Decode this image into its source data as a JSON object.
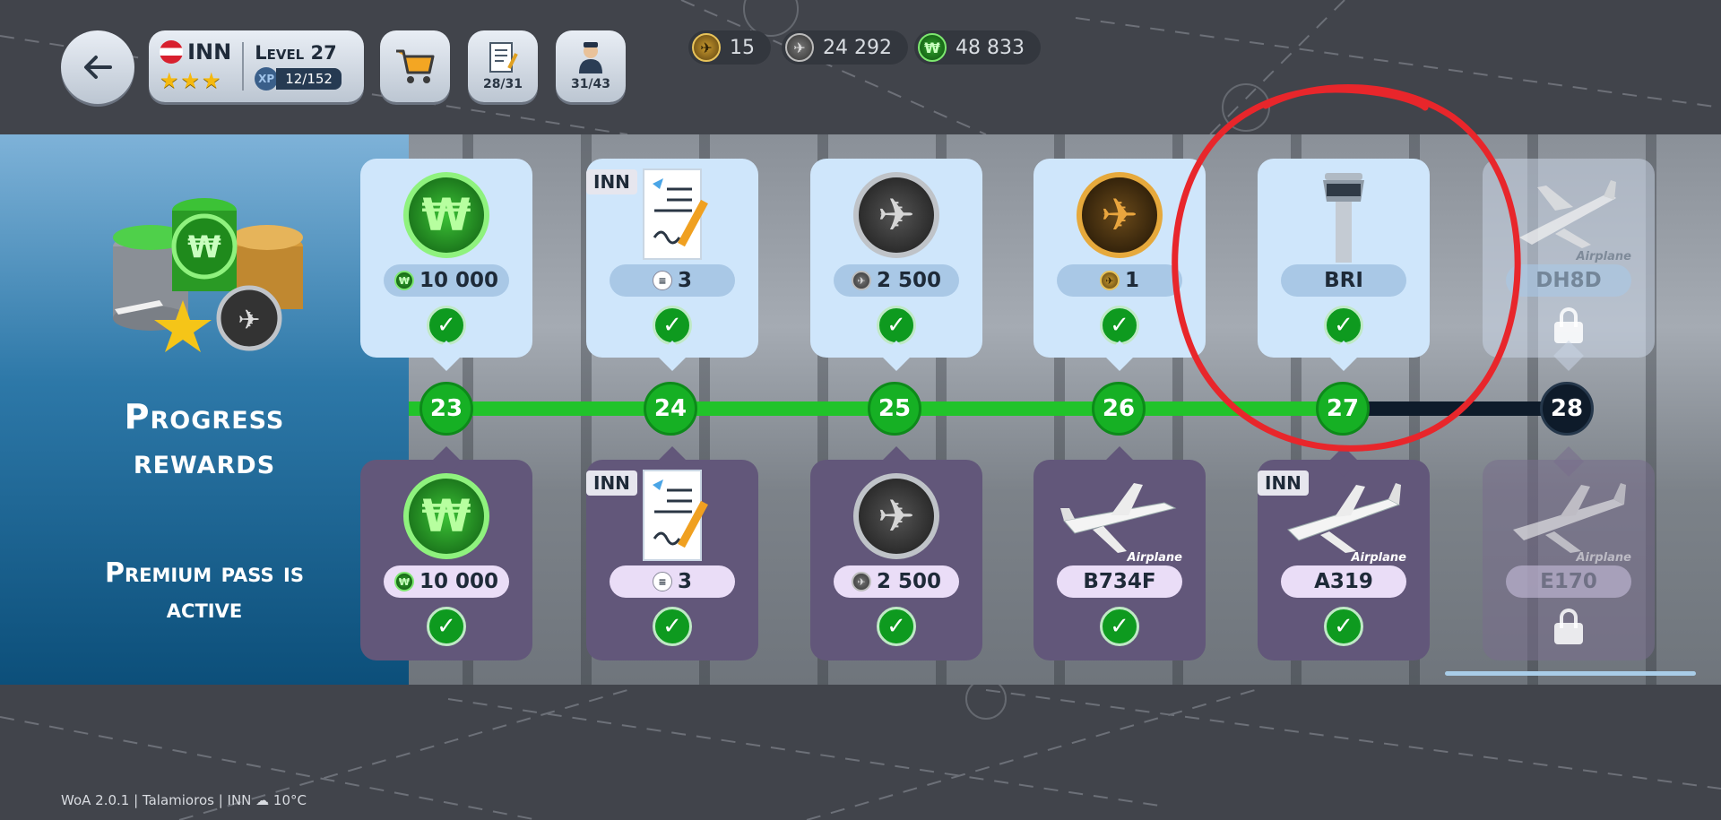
{
  "profile": {
    "code": "INN",
    "stars": "★★★",
    "level_label": "Level 27",
    "xp_label": "XP",
    "xp": "12/152"
  },
  "buttons": {
    "contracts_count": "28/31",
    "crew_count": "31/43"
  },
  "currencies": [
    {
      "icon": "gold-plane-coin-icon",
      "value": "15"
    },
    {
      "icon": "silver-plane-coin-icon",
      "value": "24 292"
    },
    {
      "icon": "green-won-coin-icon",
      "value": "48 833"
    }
  ],
  "side": {
    "title_line1": "Progress",
    "title_line2": "rewards",
    "sub_line1": "Premium pass is",
    "sub_line2": "active"
  },
  "levels": [
    "23",
    "24",
    "25",
    "26",
    "27",
    "28"
  ],
  "free_rewards": [
    {
      "value": "10 000"
    },
    {
      "tag": "INN",
      "value": "3"
    },
    {
      "value": "2 500"
    },
    {
      "value": "1"
    },
    {
      "value": "BRI"
    },
    {
      "airplane_label": "Airplane",
      "value": "DH8D"
    }
  ],
  "premium_rewards": [
    {
      "value": "10 000"
    },
    {
      "tag": "INN",
      "value": "3"
    },
    {
      "value": "2 500"
    },
    {
      "airplane_label": "Airplane",
      "value": "B734F"
    },
    {
      "tag": "INN",
      "airplane_label": "Airplane",
      "value": "A319"
    },
    {
      "airplane_label": "Airplane",
      "value": "E170"
    }
  ],
  "footer": "WoA 2.0.1 | Talamioros | INN ☁ 10°C",
  "colors": {
    "progress_green": "#21c32a",
    "annotation_red": "#e8262b",
    "premium_card": "#62577a",
    "free_card": "#cfe6fb"
  }
}
